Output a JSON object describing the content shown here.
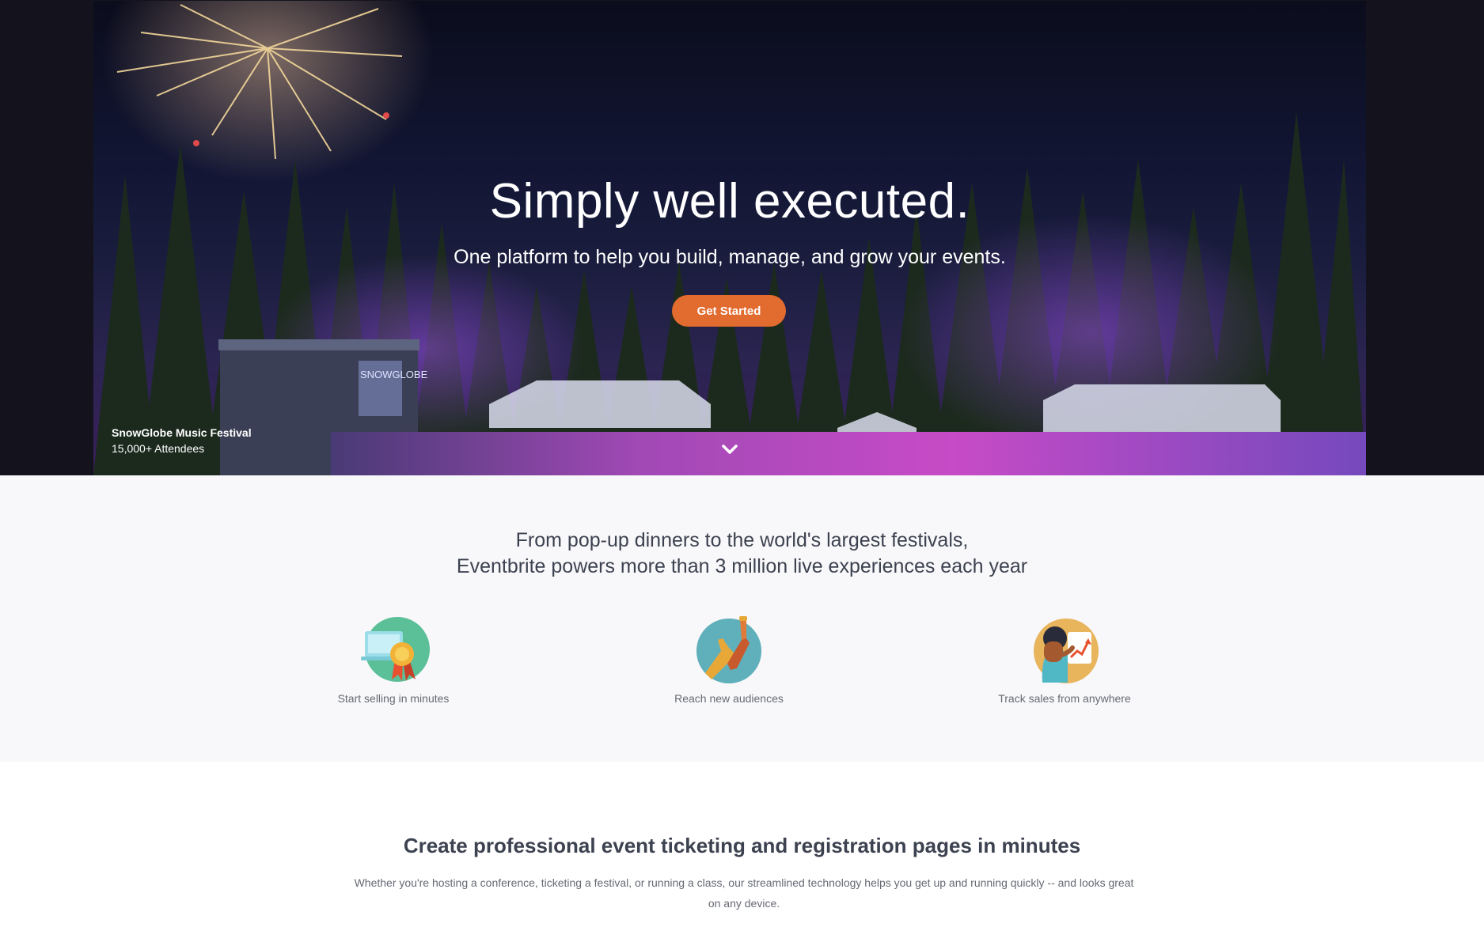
{
  "hero": {
    "title": "Simply well executed.",
    "subtitle": "One platform to help you build, manage, and grow your events.",
    "cta_label": "Get Started",
    "caption_name": "SnowGlobe Music Festival",
    "caption_attendees": "15,000+ Attendees",
    "stage_sign": "SNOWGLOBE"
  },
  "intro": {
    "line1": "From pop-up dinners to the world's largest festivals,",
    "line2": "Eventbrite powers more than 3 million live experiences each year"
  },
  "features": [
    {
      "label": "Start selling in minutes",
      "icon": "laptop-award-icon"
    },
    {
      "label": "Reach new audiences",
      "icon": "bottles-cheers-icon"
    },
    {
      "label": "Track sales from anywhere",
      "icon": "person-chart-icon"
    }
  ],
  "ticketing": {
    "heading": "Create professional event ticketing and registration pages in minutes",
    "description": "Whether you're hosting a conference, ticketing a festival, or running a class, our streamlined technology helps you get up and running quickly -- and looks great on any device."
  },
  "colors": {
    "cta": "#e26b2f",
    "hero_bg": "#14131d",
    "section_gray": "#f8f8fa",
    "heading_text": "#3d4250",
    "body_text": "#666a73"
  }
}
